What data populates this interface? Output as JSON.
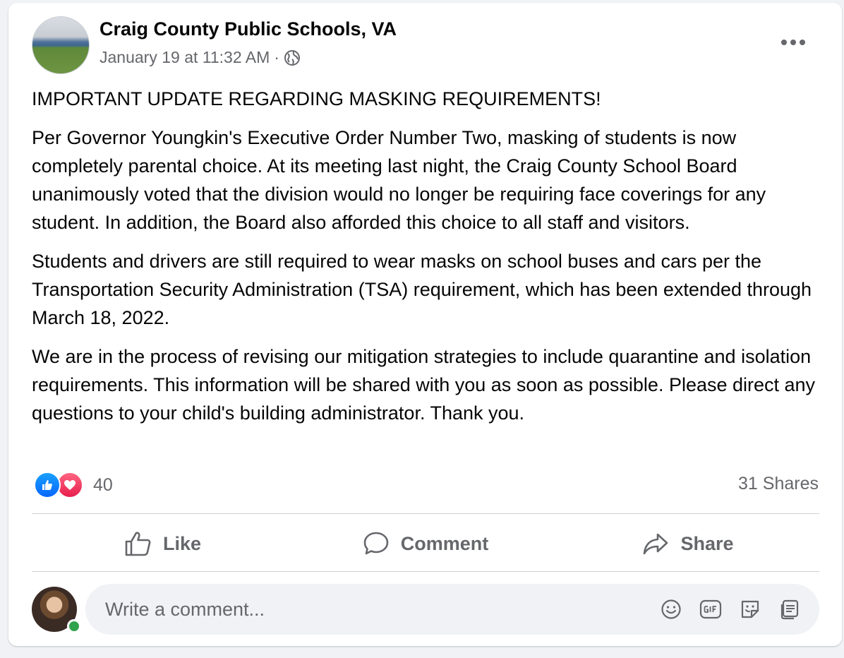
{
  "post": {
    "page_name": "Craig County Public Schools, VA",
    "timestamp": "January 19 at 11:32 AM",
    "separator": "·",
    "audience_icon": "globe-icon",
    "menu_icon": "more-options-icon",
    "paragraphs": [
      "IMPORTANT UPDATE REGARDING MASKING REQUIREMENTS!",
      "Per Governor Youngkin's Executive Order Number Two, masking of students is now completely parental choice.  At its meeting last night, the Craig County School Board unanimously voted that the division would no longer be requiring face coverings for any student.  In addition, the Board also afforded this choice to all staff and visitors.",
      "Students and drivers are still required to wear masks on school buses and cars per the Transportation Security Administration (TSA) requirement, which has been extended through March 18, 2022.",
      "We are in the process of revising our mitigation strategies to include quarantine and isolation requirements.  This information will be shared with you as soon as possible.  Please direct any questions to your child's building administrator.  Thank you."
    ]
  },
  "engagement": {
    "reaction_icons": [
      "like-reaction-icon",
      "love-reaction-icon"
    ],
    "reaction_count": "40",
    "shares": "31 Shares"
  },
  "actions": {
    "like": "Like",
    "comment": "Comment",
    "share": "Share"
  },
  "comment_box": {
    "placeholder": "Write a comment...",
    "tools": [
      "emoji-icon",
      "gif-icon",
      "sticker-icon",
      "avatar-sticker-icon"
    ]
  },
  "colors": {
    "accent_blue": "#0866ff",
    "love_red": "#e61e4d",
    "secondary_text": "#65676b",
    "online_green": "#31a24c"
  }
}
